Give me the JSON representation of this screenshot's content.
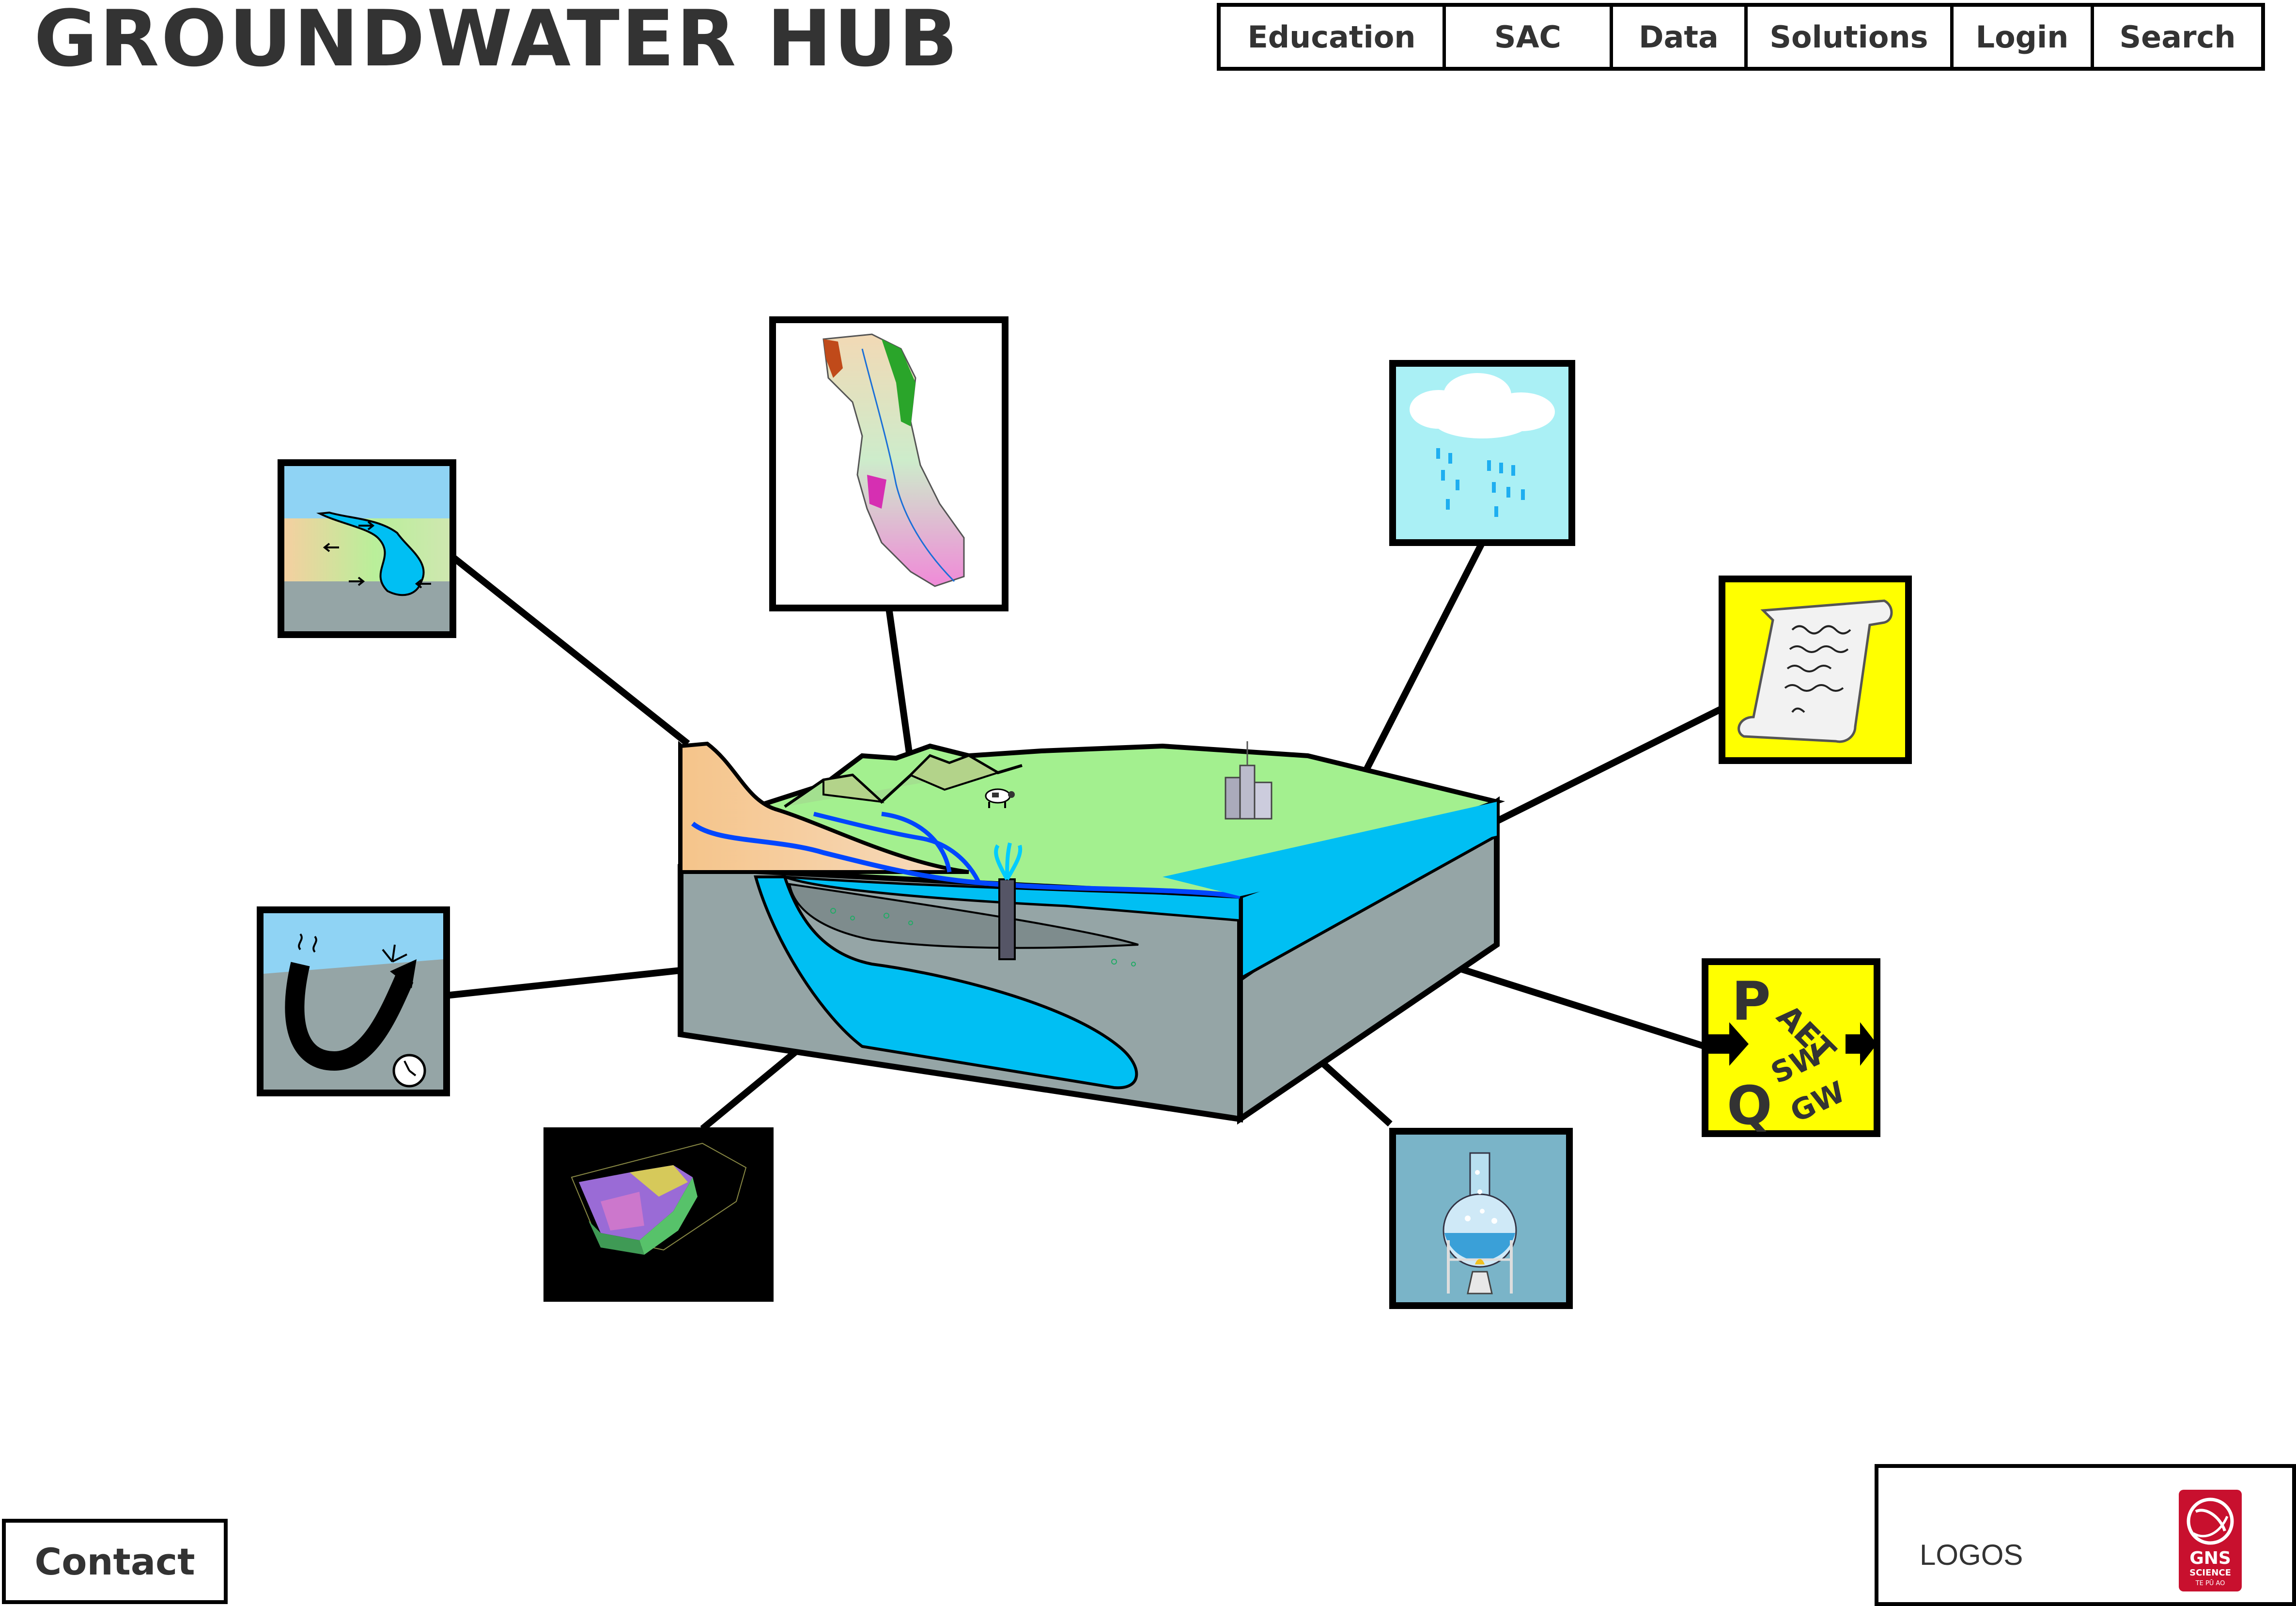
{
  "header": {
    "title": "GROUNDWATER HUB"
  },
  "nav": {
    "items": [
      {
        "label": "Education"
      },
      {
        "label": "SAC"
      },
      {
        "label": "Data"
      },
      {
        "label": "Solutions"
      },
      {
        "label": "Login"
      },
      {
        "label": "Search"
      }
    ]
  },
  "footer": {
    "contact_label": "Contact",
    "logos_label": "LOGOS",
    "gns_logo_text": "GNS",
    "gns_logo_sub1": "SCIENCE",
    "gns_logo_sub2": "TE PŪ AO"
  },
  "icons": {
    "river_exchange": "river-groundwater-exchange-icon",
    "catchment_map": "catchment-map-icon",
    "rain": "rain-cloud-icon",
    "policy": "policy-scroll-icon",
    "water_balance": "water-balance-icon",
    "chemistry": "chemistry-flask-icon",
    "model_3d": "3d-geological-model-icon",
    "age_dating": "groundwater-age-icon"
  },
  "water_balance_terms": {
    "p": "P",
    "aet": "AET",
    "qsw": "Q",
    "sw": "SW",
    "gw": "GW"
  },
  "colors": {
    "sky": "#8fd3f4",
    "ground": "#99cc77",
    "aquifer": "#00bff3",
    "rock": "#95a5a6",
    "yellow": "#ffff00",
    "flask_bg": "#7ab4c8"
  }
}
